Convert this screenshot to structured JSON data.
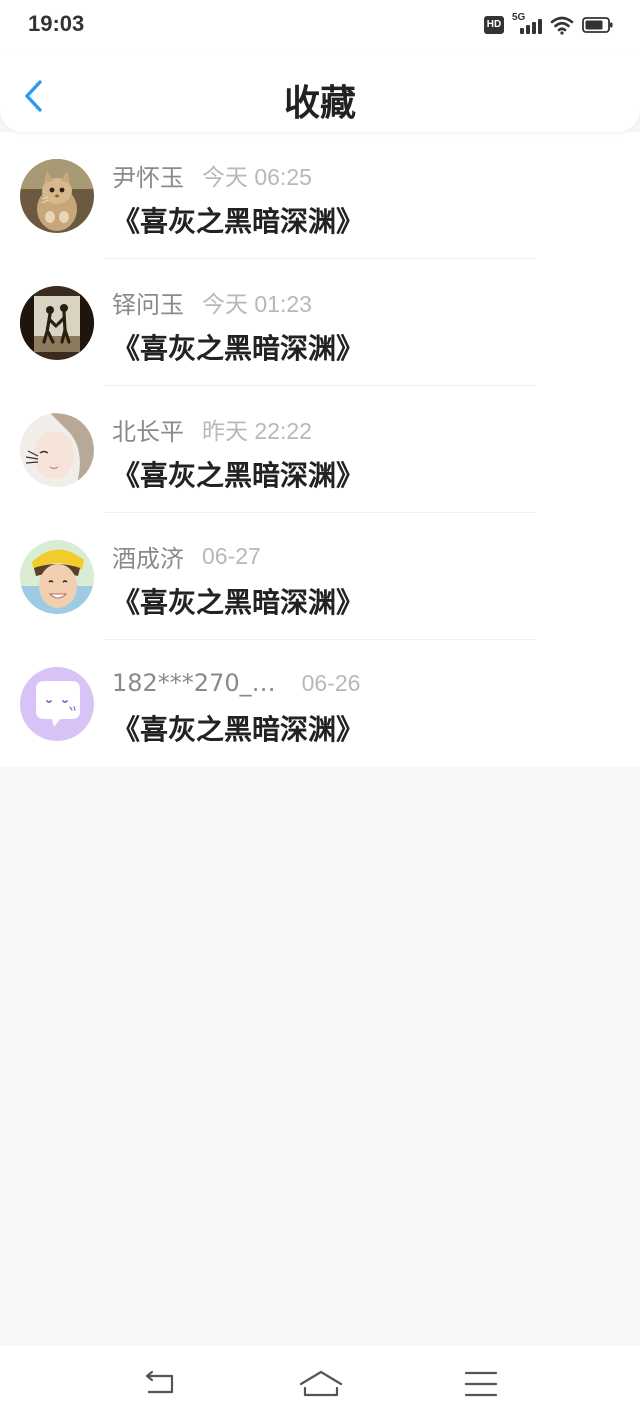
{
  "status_bar": {
    "time": "19:03",
    "hd_label": "HD",
    "network_label": "5G",
    "icons": [
      "hd-icon",
      "signal-icon",
      "wifi-icon",
      "battery-icon"
    ]
  },
  "header": {
    "title": "收藏",
    "back_icon": "chevron-left-icon",
    "accent_color": "#2a9cf0"
  },
  "favorites": [
    {
      "name": "尹怀玉",
      "time": "今天 06:25",
      "title": "《喜灰之黑暗深渊》",
      "avatar": "cat-photo-avatar"
    },
    {
      "name": "铎问玉",
      "time": "今天 01:23",
      "title": "《喜灰之黑暗深渊》",
      "avatar": "couple-photo-avatar"
    },
    {
      "name": "北长平",
      "time": "昨天 22:22",
      "title": "《喜灰之黑暗深渊》",
      "avatar": "girl-photo-avatar"
    },
    {
      "name": "酒成济",
      "time": "06-27",
      "title": "《喜灰之黑暗深渊》",
      "avatar": "boy-photo-avatar"
    },
    {
      "name": "182***270_…",
      "time": "06-26",
      "title": "《喜灰之黑暗深渊》",
      "avatar": "default-chat-avatar"
    }
  ],
  "nav_bar": {
    "icons": [
      "back-nav-icon",
      "home-nav-icon",
      "menu-nav-icon"
    ]
  }
}
